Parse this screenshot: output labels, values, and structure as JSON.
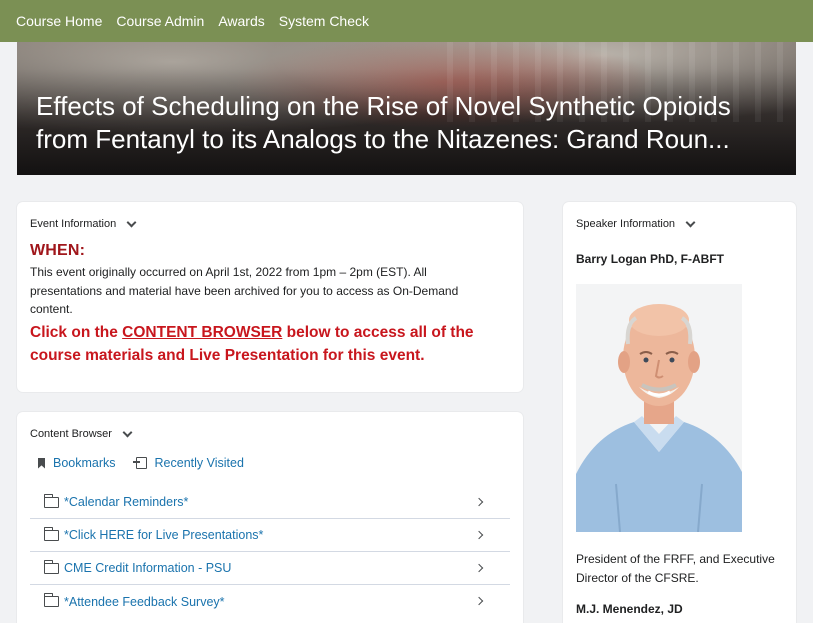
{
  "nav": {
    "items": [
      "Course Home",
      "Course Admin",
      "Awards",
      "System Check"
    ]
  },
  "banner": {
    "title": "Effects of Scheduling on the Rise of Novel Synthetic Opioids from Fentanyl to its Analogs to the Nitazenes: Grand Roun..."
  },
  "event": {
    "header": "Event Information",
    "when_label": "WHEN:",
    "description": "This event originally occurred on April 1st, 2022 from 1pm  – 2pm (EST). All presentations and material have been archived for you to access as On-Demand content.",
    "cta_before": "Click on the ",
    "cta_link": "CONTENT BROWSER",
    "cta_after": " below to access all of the course materials and Live Presentation for this event."
  },
  "content_browser": {
    "header": "Content Browser",
    "bookmarks_label": "Bookmarks",
    "recent_label": "Recently Visited",
    "modules": [
      "*Calendar Reminders*",
      "*Click HERE for Live Presentations*",
      "CME Credit Information - PSU",
      "*Attendee Feedback Survey*"
    ]
  },
  "speaker": {
    "header": "Speaker Information",
    "name": "Barry Logan PhD, F-ABFT",
    "bio": "President of the FRFF, and Executive Director of the CFSRE.",
    "name2": "M.J. Menendez, JD"
  },
  "colors": {
    "nav_bg": "#7b9054",
    "when_red": "#a0161b",
    "cta_red": "#c8161d",
    "link_blue": "#1a73ad"
  }
}
